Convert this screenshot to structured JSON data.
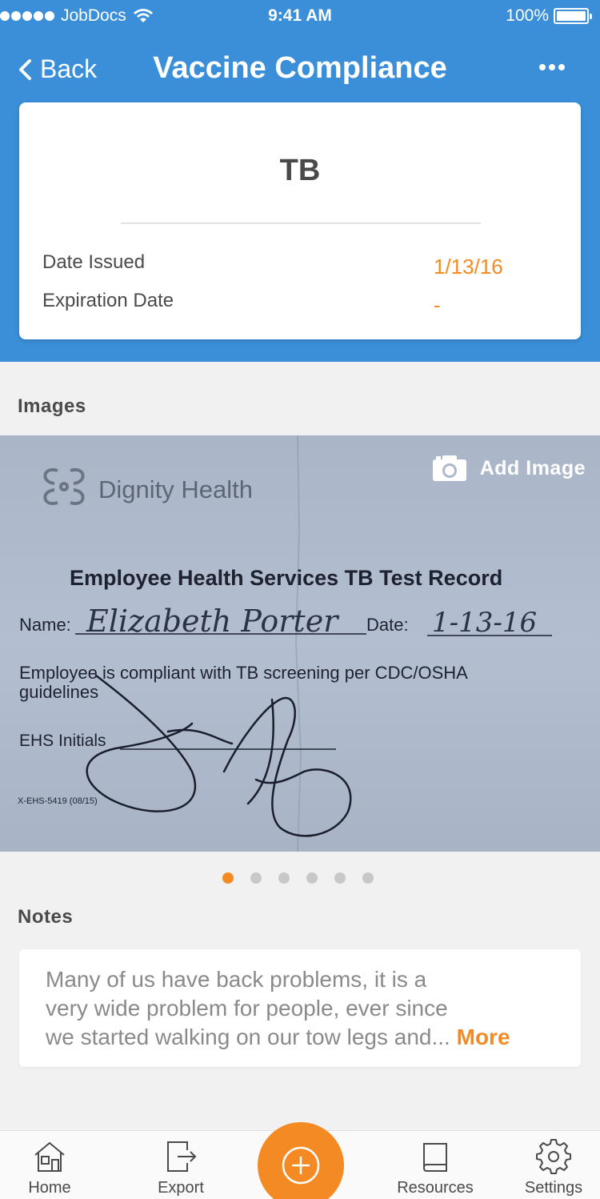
{
  "status_bar": {
    "carrier": "JobDocs",
    "time": "9:41 AM",
    "battery": "100%"
  },
  "nav": {
    "back_label": "Back",
    "title": "Vaccine Compliance"
  },
  "record": {
    "title": "TB",
    "date_issued_label": "Date Issued",
    "date_issued_value": "1/13/16",
    "expiration_label": "Expiration Date",
    "expiration_value": "-"
  },
  "images": {
    "section_label": "Images",
    "add_image_label": "Add Image",
    "document": {
      "logo_text": "Dignity Health",
      "heading": "Employee Health Services TB Test Record",
      "name_label": "Name:",
      "name_value": "Elizabeth Porter",
      "date_label": "Date:",
      "date_value": "1-13-16",
      "compliance_line1": "Employee is compliant with TB screening per CDC/OSHA",
      "compliance_line2": "guidelines",
      "initials_label": "EHS Initials",
      "form_code": "X-EHS-5419 (08/15)"
    },
    "pager": {
      "count": 6,
      "active_index": 0
    }
  },
  "notes": {
    "section_label": "Notes",
    "line1": "Many of us have back problems, it is a",
    "line2": "very wide problem for people, ever since",
    "line3": "we started walking on our tow legs and...",
    "more_label": "More"
  },
  "tab_bar": {
    "items": [
      {
        "label": "Home",
        "icon": "home-icon"
      },
      {
        "label": "Export",
        "icon": "export-icon"
      },
      {
        "label": "Resources",
        "icon": "book-icon"
      },
      {
        "label": "Settings",
        "icon": "gear-icon"
      }
    ],
    "fab_icon": "plus-circle-icon"
  },
  "colors": {
    "header_blue": "#3a8fd8",
    "accent_orange": "#f38a23",
    "background": "#f1f1f1"
  }
}
